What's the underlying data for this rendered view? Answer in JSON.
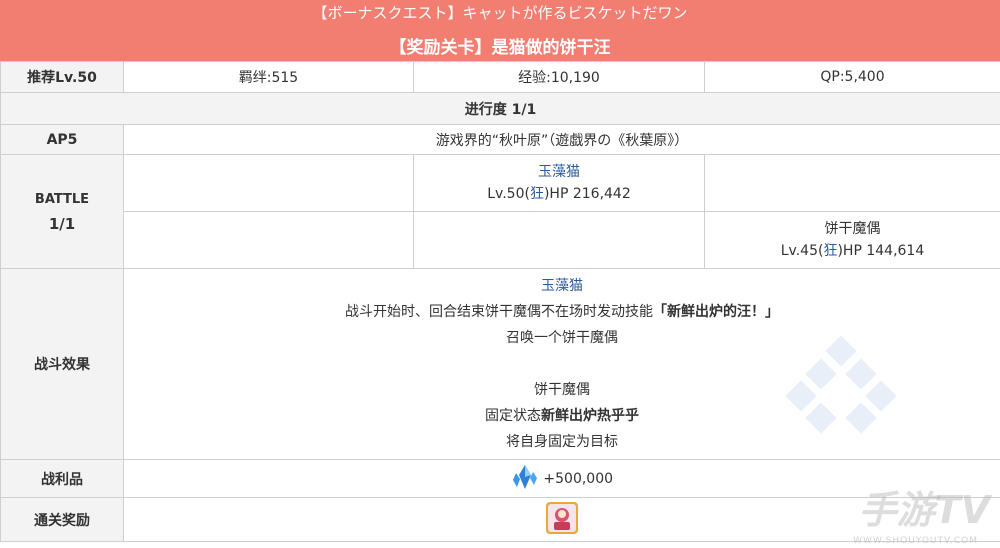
{
  "header": {
    "title_jp": "【ボーナスクエスト】キャットが作るビスケットだワン",
    "title_cn": "【奖励关卡】是猫做的饼干汪"
  },
  "rewards_row": {
    "recommended": "推荐Lv.50",
    "bond": "羁绊:515",
    "exp": "经验:10,190",
    "qp": "QP:5,400"
  },
  "progress": "进行度 1/1",
  "ap": {
    "label": "AP5",
    "location": "游戏界的“秋叶原”（遊戯界の《秋葉原》）"
  },
  "battle": {
    "label": "BATTLE",
    "count": "1/1",
    "enemy1": {
      "name": "玉藻猫",
      "lv_prefix": "Lv.50(",
      "class_name": "狂",
      "hp_suffix": ")HP 216,442"
    },
    "enemy2": {
      "name": "饼干魔偶",
      "lv_prefix": "Lv.45(",
      "class_name": "狂",
      "hp_suffix": ")HP 144,614"
    }
  },
  "effects": {
    "label": "战斗效果",
    "line1": "玉藻猫",
    "line2_text": "战斗开始时、回合结束饼干魔偶不在场时发动技能",
    "line2_skill": "「新鲜出炉的汪！」",
    "line3": "召唤一个饼干魔偶",
    "line4": "饼干魔偶",
    "line5_text": "固定状态",
    "line5_bold": "新鲜出炉热乎乎",
    "line6": "将自身固定为目标"
  },
  "drops": {
    "label": "战利品",
    "value": "+500,000",
    "icon": "qp-crystal-icon"
  },
  "clear_reward": {
    "label": "通关奖励",
    "icon": "craft-essence-icon"
  },
  "watermark": {
    "main": "手游TV",
    "sub": "WWW.SHOUYOUTV.COM"
  },
  "colors": {
    "header_bg": "#f27d71",
    "link": "#2a5a9b",
    "label_bg": "#f3f3f3",
    "border": "#cfcfcf"
  }
}
